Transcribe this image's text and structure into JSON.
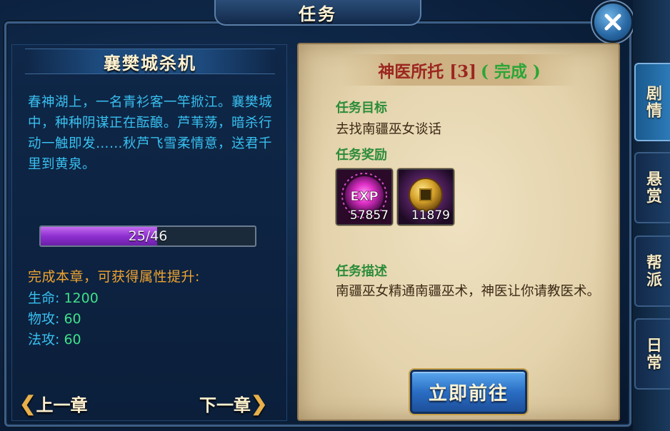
{
  "window": {
    "title": "任务",
    "close_icon": "close-icon"
  },
  "chapter": {
    "title": "襄樊城杀机",
    "description": "春神湖上，一名青衫客一竿掀江。襄樊城中，种种阴谋正在酝酿。芦苇荡，暗杀行动一触即发……秋芦飞雪柔情意，送君千里到黄泉。",
    "progress": {
      "current": 25,
      "total": 46,
      "label": "25/46"
    },
    "reward_heading": "完成本章，可获得属性提升:",
    "stats": [
      {
        "label": "生命:",
        "value": "1200"
      },
      {
        "label": "物攻:",
        "value": "60"
      },
      {
        "label": "法攻:",
        "value": "60"
      }
    ],
    "prev_label": "上一章",
    "next_label": "下一章"
  },
  "quest": {
    "name": "神医所托 [3]",
    "status": "( 完成 )",
    "objective_label": "任务目标",
    "objective_text": "去找南疆巫女谈话",
    "reward_label": "任务奖励",
    "rewards": [
      {
        "icon": "exp-orb-icon",
        "badge": "EXP",
        "count": "57857"
      },
      {
        "icon": "copper-coin-icon",
        "count": "11879"
      }
    ],
    "description_label": "任务描述",
    "description_text": "南疆巫女精通南疆巫术，神医让你请教医术。",
    "go_button": "立即前往"
  },
  "side_tabs": [
    {
      "label": "剧情",
      "active": true
    },
    {
      "label": "悬赏",
      "active": false
    },
    {
      "label": "帮派",
      "active": false
    },
    {
      "label": "日常",
      "active": false
    }
  ],
  "colors": {
    "desc_blue": "#38c0f0",
    "stat_green": "#3fe08a",
    "reward_orange": "#f0a430",
    "quest_red": "#9c2620",
    "quest_green": "#2aa637",
    "progress_purple": "#8e2fd0"
  }
}
